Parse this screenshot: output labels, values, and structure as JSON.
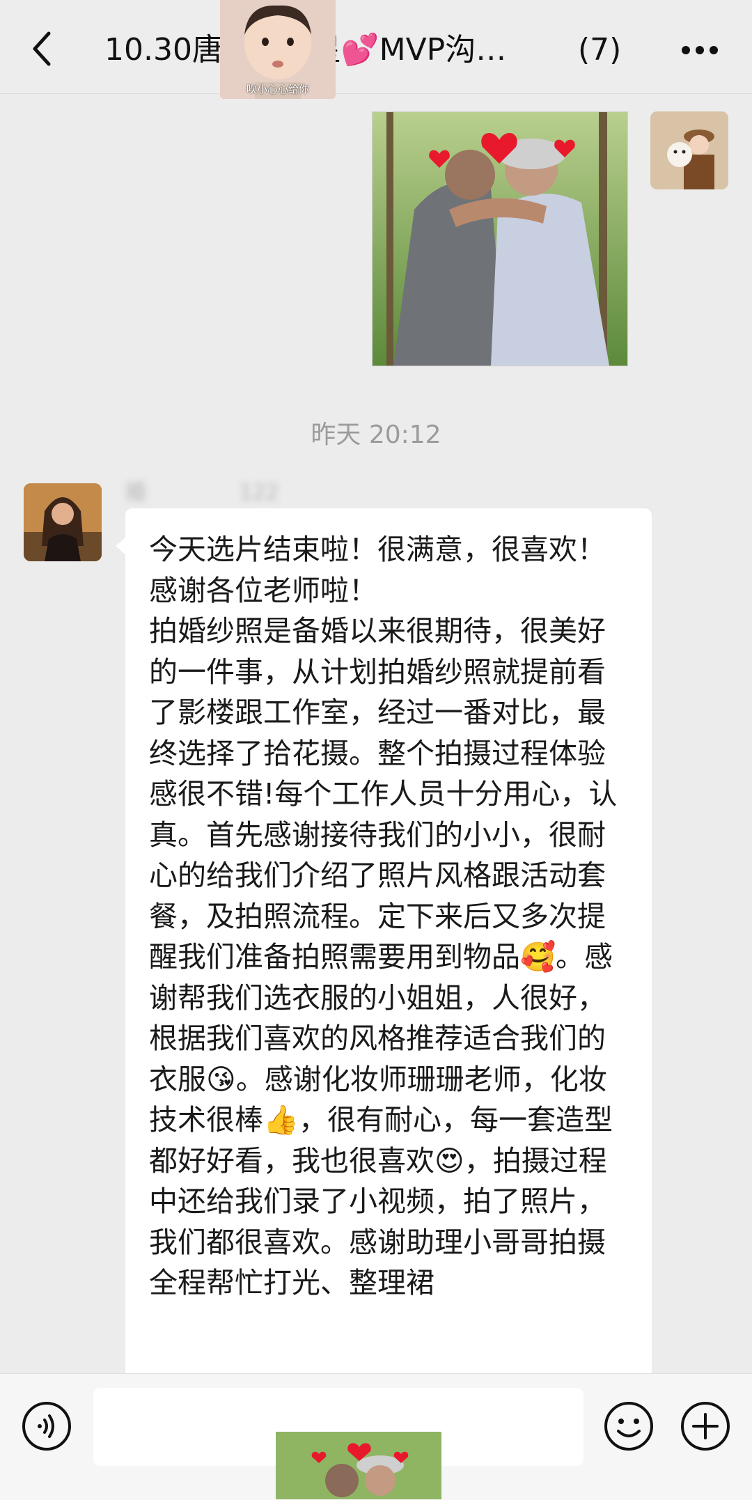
{
  "header": {
    "title": "10.30唐         星💕MVP沟…",
    "member_count": "(7)",
    "back_icon": "chevron-left-icon",
    "more_icon": "more-dots-icon"
  },
  "sticker": {
    "caption": "吹小心心给你"
  },
  "messages": {
    "timestamp": "昨天 20:12",
    "sender_name": "婚              122",
    "text": "今天选片结束啦！很满意，很喜欢！感谢各位老师啦！\n拍婚纱照是备婚以来很期待，很美好的一件事，从计划拍婚纱照就提前看了影楼跟工作室，经过一番对比，最终选择了拾花摄。整个拍摄过程体验感很不错!每个工作人员十分用心，认真。首先感谢接待我们的小小，很耐心的给我们介绍了照片风格跟活动套餐，及拍照流程。定下来后又多次提醒我们准备拍照需要用到物品🥰。感谢帮我们选衣服的小姐姐，人很好，根据我们喜欢的风格推荐适合我们的衣服😘。感谢化妆师珊珊老师，化妆技术很棒👍，很有耐心，每一套造型都好好看，我也很喜欢😍，拍摄过程中还给我们录了小视频，拍了照片，我们都很喜欢。感谢助理小哥哥拍摄全程帮忙打光、整理裙"
  },
  "input_bar": {
    "voice_icon": "voice-icon",
    "emoji_icon": "smiley-icon",
    "plus_icon": "plus-icon",
    "input_value": ""
  },
  "colors": {
    "background": "#ececec",
    "bubble": "#ffffff",
    "header": "#ededed",
    "heart": "#e8192c"
  }
}
